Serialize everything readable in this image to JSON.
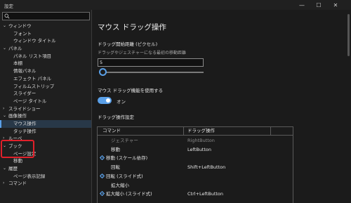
{
  "window": {
    "title": "設定",
    "controls": {
      "minimize": "—",
      "maximize": "☐",
      "close": "✕"
    }
  },
  "sidebar": {
    "search": {
      "value": "",
      "placeholder": ""
    },
    "items": [
      {
        "label": "ウィンドウ",
        "level": 0,
        "expanded": true
      },
      {
        "label": "フォント",
        "level": 1
      },
      {
        "label": "ウィンドウ タイトル",
        "level": 1
      },
      {
        "label": "パネル",
        "level": 0,
        "expanded": true
      },
      {
        "label": "パネル リスト項目",
        "level": 1
      },
      {
        "label": "本棚",
        "level": 1
      },
      {
        "label": "情報パネル",
        "level": 1
      },
      {
        "label": "エフェクト パネル",
        "level": 1
      },
      {
        "label": "フィルムストリップ",
        "level": 1
      },
      {
        "label": "スライダー",
        "level": 1
      },
      {
        "label": "ページ タイトル",
        "level": 1
      },
      {
        "label": "スライドショー",
        "level": 0
      },
      {
        "label": "画像操作",
        "level": 0,
        "expanded": true
      },
      {
        "label": "マウス操作",
        "level": 1,
        "selected": true
      },
      {
        "label": "タッチ操作",
        "level": 1
      },
      {
        "label": "ルーペ",
        "level": 0
      },
      {
        "label": "ブック",
        "level": 0,
        "expanded": true
      },
      {
        "label": "ページ設定",
        "level": 1
      },
      {
        "label": "移動",
        "level": 1
      },
      {
        "label": "履歴",
        "level": 0,
        "expanded": true
      },
      {
        "label": "ページ表示記録",
        "level": 1
      },
      {
        "label": "コマンド",
        "level": 0
      }
    ]
  },
  "main": {
    "title": "マウス ドラッグ操作",
    "drag_start": {
      "label": "ドラッグ開始距離 (ピクセル)",
      "description": "ドラッグやジェスチャーになる最初の移動距離",
      "value": "5",
      "slider_fraction": 0.05
    },
    "mouse_drag": {
      "label": "マウス ドラッグ機能を使用する",
      "toggle_on": true,
      "toggle_text": "オン"
    },
    "table_section_label": "ドラッグ操作設定",
    "table": {
      "headers": [
        "コマンド",
        "ドラッグ操作"
      ],
      "rows": [
        {
          "command": "ジェスチャー",
          "key": "RightButton",
          "kind": "child",
          "disabled": true
        },
        {
          "command": "移動",
          "key": "LeftButton",
          "kind": "child"
        },
        {
          "command": "移動 (スケール依存)",
          "key": "",
          "kind": "group"
        },
        {
          "command": "回転",
          "key": "Shift+LeftButton",
          "kind": "child"
        },
        {
          "command": "回転 (スライド式)",
          "key": "",
          "kind": "group"
        },
        {
          "command": "拡大縮小",
          "key": "",
          "kind": "child"
        },
        {
          "command": "拡大縮小 (スライド式)",
          "key": "Ctrl+LeftButton",
          "kind": "group"
        }
      ]
    }
  },
  "colors": {
    "accent": "#5aa0e8",
    "highlight_box": "#e0202a",
    "background": "#1b1b1b"
  },
  "icons": {
    "search": "search-icon",
    "gear": "gear-icon",
    "expand": "chevron-down-icon"
  }
}
